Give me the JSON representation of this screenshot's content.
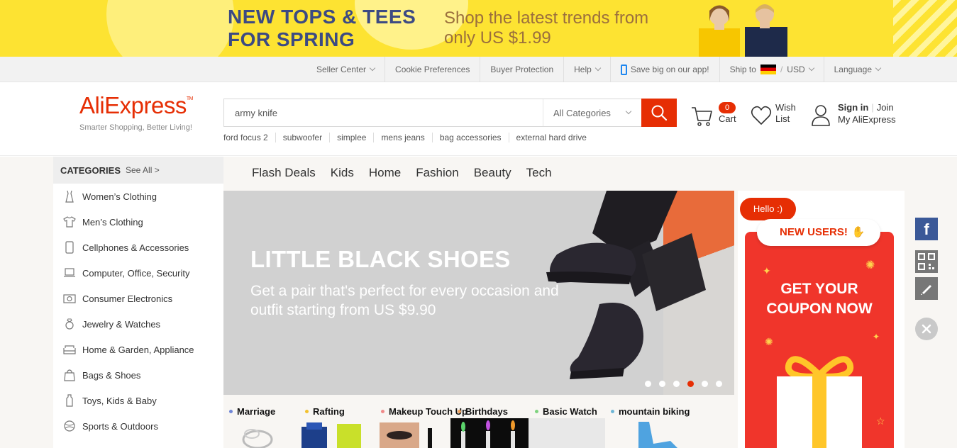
{
  "promo": {
    "headline": "NEW TOPS & TEES FOR SPRING",
    "subline": "Shop the latest trends from only US $1.99"
  },
  "topnav": {
    "seller_center": "Seller Center",
    "cookie_preferences": "Cookie Preferences",
    "buyer_protection": "Buyer Protection",
    "help": "Help",
    "app": "Save big on our app!",
    "ship_to": "Ship to",
    "currency_sep": "/",
    "currency": "USD",
    "language": "Language"
  },
  "header": {
    "logo": "AliExpress",
    "logo_tm": "TM",
    "tagline": "Smarter Shopping, Better Living!",
    "search_value": "army knife",
    "search_category": "All Categories",
    "hot_searches": [
      "ford focus 2",
      "subwoofer",
      "simplee",
      "mens jeans",
      "bag accessories",
      "external hard drive"
    ],
    "cart_count": "0",
    "cart_label": "Cart",
    "wish_label": "Wish List",
    "sign_in": "Sign in",
    "join": "Join",
    "my_account": "My AliExpress"
  },
  "sidebar": {
    "title": "CATEGORIES",
    "see_all": "See All >",
    "items": [
      {
        "label": "Women’s Clothing",
        "icon": "dress-icon"
      },
      {
        "label": "Men’s Clothing",
        "icon": "shirt-icon"
      },
      {
        "label": "Cellphones & Accessories",
        "icon": "phone-icon"
      },
      {
        "label": "Computer, Office, Security",
        "icon": "laptop-icon"
      },
      {
        "label": "Consumer Electronics",
        "icon": "camera-icon"
      },
      {
        "label": "Jewelry & Watches",
        "icon": "ring-icon"
      },
      {
        "label": "Home & Garden, Appliance",
        "icon": "sofa-icon"
      },
      {
        "label": "Bags & Shoes",
        "icon": "bag-icon"
      },
      {
        "label": "Toys, Kids & Baby",
        "icon": "bottle-icon"
      },
      {
        "label": "Sports & Outdoors",
        "icon": "ball-icon"
      }
    ]
  },
  "tabs": [
    "Flash Deals",
    "Kids",
    "Home",
    "Fashion",
    "Beauty",
    "Tech"
  ],
  "hero": {
    "title": "LITTLE BLACK SHOES",
    "subtitle": "Get a pair that's perfect for every occasion and outfit starting from US $9.90",
    "slide_count": 6,
    "active_slide": 4
  },
  "mini_categories": [
    {
      "label": "Marriage",
      "color": "#6f86d6"
    },
    {
      "label": "Rafting",
      "color": "#f2c12e"
    },
    {
      "label": "Makeup Touch Up",
      "color": "#f08a8a"
    },
    {
      "label": "Birthdays",
      "color": "#f0a05a"
    },
    {
      "label": "Basic Watch",
      "color": "#7fd37f"
    },
    {
      "label": "mountain biking",
      "color": "#6fb6d6"
    }
  ],
  "coupon": {
    "hello": "Hello :)",
    "new_users": "NEW USERS!",
    "get_coupon": "GET YOUR COUPON NOW"
  },
  "rail": {
    "facebook": "f"
  },
  "colors": {
    "brand": "#e62e04",
    "promo_bg": "#fde332",
    "promo_headline": "#3c4a83",
    "coupon_red": "#f0352b",
    "facebook": "#3b5998"
  }
}
